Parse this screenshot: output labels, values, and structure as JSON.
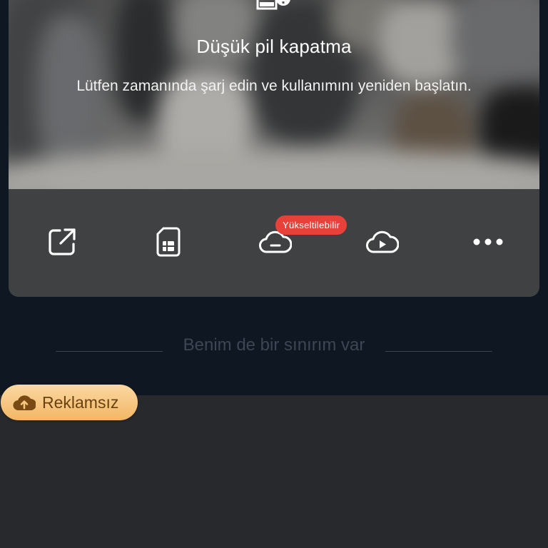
{
  "notice": {
    "title": "Düşük pil kapatma",
    "message": "Lütfen zamanında şarj edin ve kullanımını yeniden başlatın.",
    "icon": "low-battery-warning-icon"
  },
  "toolbar": {
    "items": [
      {
        "id": "share",
        "icon": "share-external-icon"
      },
      {
        "id": "sim",
        "icon": "sim-card-icon"
      },
      {
        "id": "cloud-storage",
        "icon": "cloud-storage-icon"
      },
      {
        "id": "cloud-playback",
        "icon": "cloud-play-icon"
      },
      {
        "id": "more",
        "icon": "more-dots-icon"
      }
    ],
    "upgrade_badge": "Yükseltilebilir"
  },
  "limit": {
    "text": "Benim de bir sınırım var"
  },
  "ad_free": {
    "label": "Reklamsız",
    "icon": "cloud-upload-icon"
  },
  "colors": {
    "background": "#0f1722",
    "card": "#404142",
    "badge": "#e8413a",
    "pill_top": "#fbd8a2",
    "pill_bottom": "#f2b763",
    "bottom_panel": "#28292c"
  }
}
